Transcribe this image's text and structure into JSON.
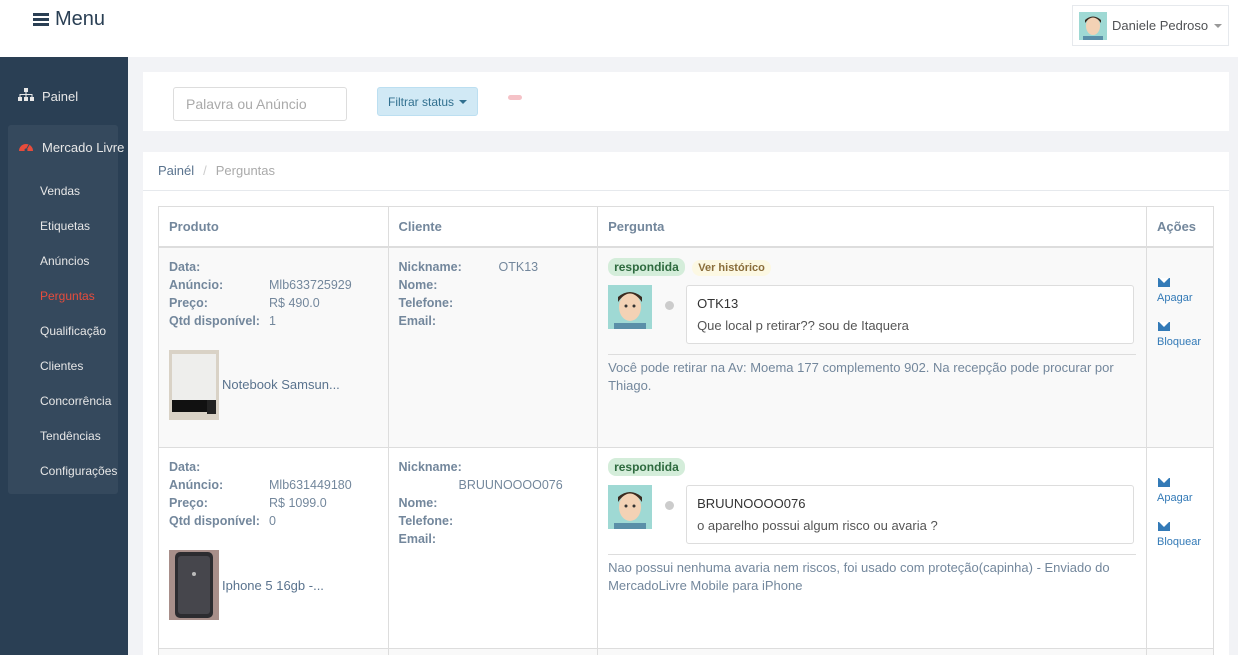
{
  "header": {
    "menu_label": "Menu",
    "user_name": "Daniele Pedroso"
  },
  "sidebar": {
    "items": [
      {
        "label": "Painel",
        "icon": "sitemap-icon"
      },
      {
        "label": "Mercado Livre",
        "icon": "tachometer-icon"
      }
    ],
    "subitems": [
      "Vendas",
      "Etiquetas",
      "Anúncios",
      "Perguntas",
      "Qualificação",
      "Clientes",
      "Concorrência",
      "Tendências",
      "Configurações"
    ],
    "current_subitem": "Perguntas"
  },
  "toolbar": {
    "search_placeholder": "Palavra ou Anúncio",
    "filter_label": "Filtrar status"
  },
  "breadcrumb": {
    "home": "Painél",
    "separator": "/",
    "current": "Perguntas"
  },
  "table": {
    "headers": [
      "Produto",
      "Cliente",
      "Pergunta",
      "Ações"
    ],
    "labels": {
      "data": "Data:",
      "anuncio": "Anúncio:",
      "preco": "Preço:",
      "qtd": "Qtd disponível:",
      "nickname": "Nickname:",
      "nome": "Nome:",
      "telefone": "Telefone:",
      "email": "Email:",
      "delete": "Apagar",
      "block": "Bloquear",
      "history": "Ver histórico"
    },
    "rows": [
      {
        "data": "",
        "anuncio": "Mlb633725929",
        "preco": "R$ 490.0",
        "qtd": "1",
        "product_name": "Notebook Samsun...",
        "nickname": "OTK13",
        "nome": "",
        "telefone": "",
        "email": "",
        "status": "respondida",
        "question_nick": "OTK13",
        "question": "Que local p retirar?? sou de Itaquera",
        "answer": "Você pode retirar na Av: Moema 177 complemento 902. Na recepção pode procurar por Thiago."
      },
      {
        "data": "",
        "anuncio": "Mlb631449180",
        "preco": "R$ 1099.0",
        "qtd": "0",
        "product_name": "Iphone 5 16gb -...",
        "nickname": "BRUUNOOOO076",
        "nome": "",
        "telefone": "",
        "email": "",
        "status": "respondida",
        "question_nick": "BRUUNOOOO076",
        "question": "o aparelho possui algum risco ou avaria ?",
        "answer": "Nao possui nenhuma avaria nem riscos, foi usado com proteção(capinha) - Enviado do MercadoLivre Mobile para iPhone"
      }
    ]
  },
  "colors": {
    "sidebar_bg": "#2A3F54",
    "active_link": "#E74C3C",
    "badge_green": "#d4edda"
  }
}
